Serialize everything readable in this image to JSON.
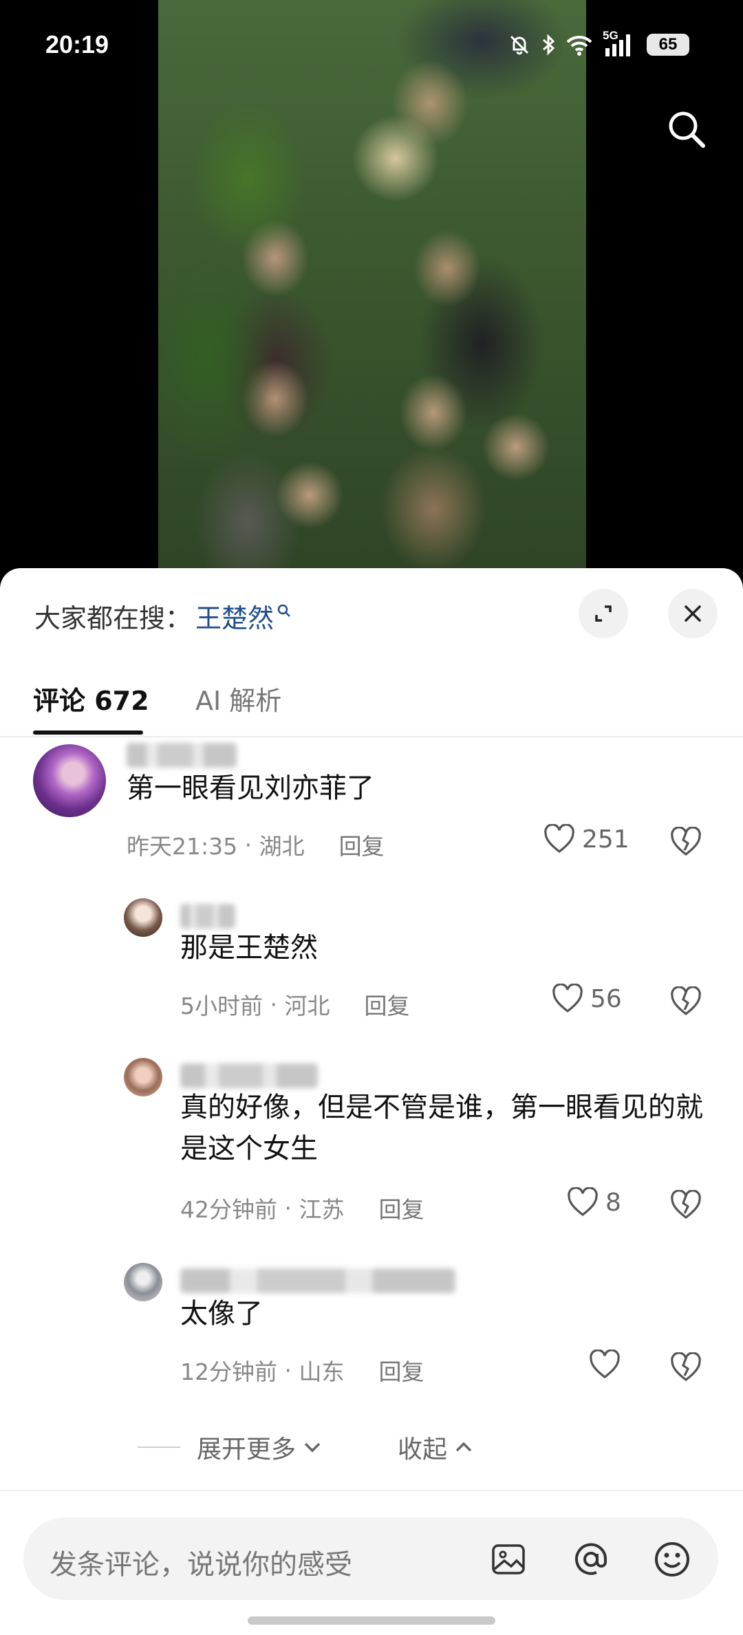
{
  "status_bar": {
    "time": "20:19",
    "network": "5G",
    "battery": "65"
  },
  "video": {
    "search_icon": "search-icon"
  },
  "header": {
    "search_prefix": "大家都在搜：",
    "search_term": "王楚然",
    "expand_icon": "expand-icon",
    "close_icon": "close-icon"
  },
  "tabs": [
    {
      "label": "评论 672",
      "active": true
    },
    {
      "label": "AI 解析",
      "active": false
    }
  ],
  "comments": [
    {
      "text": "第一眼看见刘亦菲了",
      "time": "昨天21:35",
      "location": "湖北",
      "reply_label": "回复",
      "likes": "251"
    },
    {
      "text": "那是王楚然",
      "time": "5小时前",
      "location": "河北",
      "reply_label": "回复",
      "likes": "56"
    },
    {
      "text": "真的好像，但是不管是谁，第一眼看见的就是这个女生",
      "time": "42分钟前",
      "location": "江苏",
      "reply_label": "回复",
      "likes": "8"
    },
    {
      "text": "太像了",
      "time": "12分钟前",
      "location": "山东",
      "reply_label": "回复",
      "likes": ""
    }
  ],
  "thread_actions": {
    "expand_more": "展开更多",
    "collapse": "收起"
  },
  "composer": {
    "placeholder": "发条评论，说说你的感受",
    "image_icon": "image-icon",
    "mention_icon": "at-icon",
    "emoji_icon": "emoji-icon"
  }
}
